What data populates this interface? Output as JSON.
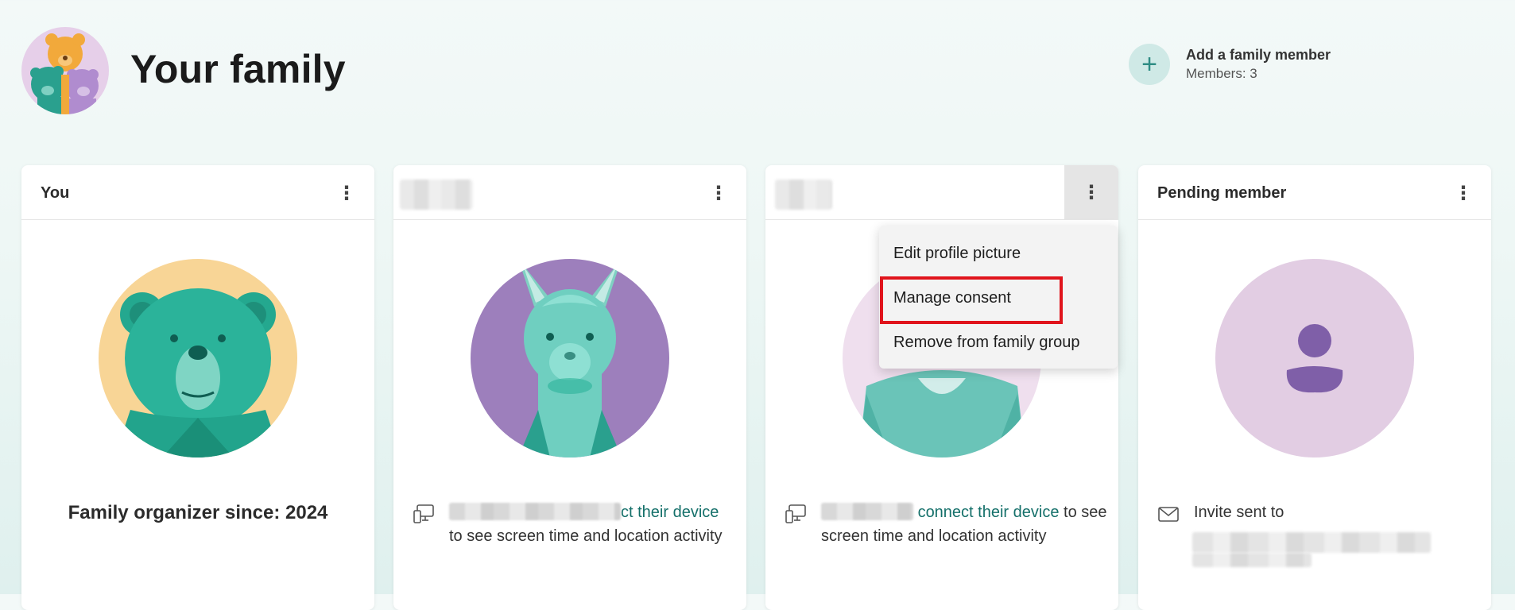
{
  "header": {
    "title": "Your family",
    "add_member_label": "Add a family member",
    "members_count": "Members: 3"
  },
  "cards": [
    {
      "title": "You",
      "organizer_text": "Family organizer since: 2024"
    },
    {
      "title": "",
      "link_text": "ct their device",
      "after_text": "to see screen time and location activity"
    },
    {
      "title": "",
      "link_text": "connect their device",
      "after_text": " to see screen time and location activity"
    },
    {
      "title": "Pending member",
      "invite_text": "Invite sent to"
    }
  ],
  "context_menu": {
    "items": [
      "Edit profile picture",
      "Manage consent",
      "Remove from family group"
    ]
  },
  "colors": {
    "accent_teal": "#15706a",
    "highlight_red": "#e0141c",
    "llama_bg": "#9d7fbc",
    "bear_bg": "#f8d596",
    "pending_bg": "#e2cde3"
  },
  "icons": [
    "bear-family-icon",
    "plus-icon",
    "more-vertical-icon",
    "device-icon",
    "mail-icon",
    "person-icon"
  ]
}
